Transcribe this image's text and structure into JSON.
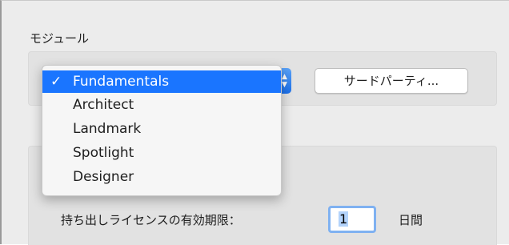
{
  "module_section": {
    "label": "モジュール",
    "third_party_button": "サードパーティ...",
    "menu": {
      "selected_index": 0,
      "check_glyph": "✓",
      "items": [
        "Fundamentals",
        "Architect",
        "Landmark",
        "Spotlight",
        "Designer"
      ]
    },
    "popup_arrows": "▲▼"
  },
  "license_section": {
    "expiry_label": "持ち出しライセンスの有効期限：",
    "days_value": "1",
    "days_unit": "日間"
  },
  "colors": {
    "accent": "#1a75ff",
    "focus_ring": "#7fb1f1"
  }
}
